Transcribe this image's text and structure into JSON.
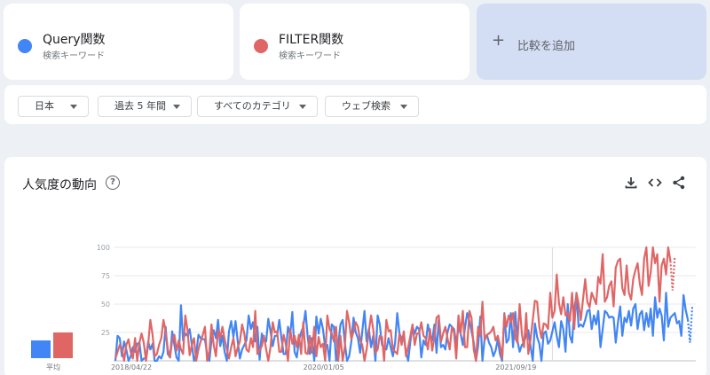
{
  "terms": [
    {
      "name": "Query関数",
      "subtitle": "検索キーワード",
      "color": "#4285f4"
    },
    {
      "name": "FILTER関数",
      "subtitle": "検索キーワード",
      "color": "#e06666"
    }
  ],
  "add_compare": {
    "plus": "+",
    "label": "比較を追加"
  },
  "filters": [
    {
      "label": "日本"
    },
    {
      "label": "過去 5 年間"
    },
    {
      "label": "すべてのカテゴリ"
    },
    {
      "label": "ウェブ検索"
    }
  ],
  "panel": {
    "title": "人気度の動向",
    "help": "?",
    "icons": [
      "download-icon",
      "embed-code-icon",
      "share-icon"
    ]
  },
  "average": {
    "label": "平均"
  },
  "chart_data": {
    "type": "line",
    "ylim": [
      0,
      100
    ],
    "y_ticks": [
      "100",
      "75",
      "50",
      "25"
    ],
    "x_ticks": [
      "2018/04/22",
      "2020/01/05",
      "2021/09/19"
    ],
    "x_tick_index": [
      0,
      88,
      176
    ],
    "average": [
      {
        "name": "Query関数",
        "value": 20
      },
      {
        "name": "FILTER関数",
        "value": 29
      }
    ],
    "series": [
      {
        "name": "Query関数",
        "color": "#4285f4",
        "values": [
          0,
          22,
          20,
          4,
          17,
          10,
          0,
          4,
          12,
          8,
          15,
          16,
          0,
          2,
          2,
          17,
          10,
          15,
          0,
          0,
          4,
          2,
          8,
          30,
          6,
          3,
          26,
          14,
          3,
          0,
          49,
          18,
          24,
          22,
          28,
          14,
          0,
          6,
          23,
          20,
          19,
          19,
          6,
          0,
          18,
          27,
          20,
          36,
          13,
          22,
          8,
          0,
          26,
          35,
          21,
          35,
          17,
          2,
          10,
          14,
          18,
          40,
          28,
          34,
          17,
          30,
          1,
          24,
          18,
          17,
          37,
          26,
          13,
          22,
          22,
          36,
          20,
          6,
          6,
          30,
          23,
          43,
          8,
          3,
          18,
          25,
          30,
          44,
          21,
          6,
          20,
          0,
          39,
          24,
          37,
          28,
          12,
          14,
          0,
          32,
          30,
          0,
          14,
          32,
          36,
          16,
          0,
          4,
          17,
          38,
          25,
          20,
          7,
          26,
          44,
          17,
          28,
          12,
          22,
          0,
          40,
          32,
          14,
          12,
          10,
          20,
          12,
          4,
          16,
          42,
          24,
          20,
          20,
          8,
          0,
          17,
          30,
          24,
          30,
          28,
          3,
          18,
          14,
          32,
          23,
          18,
          32,
          7,
          36,
          12,
          14,
          10,
          25,
          32,
          30,
          28,
          15,
          30,
          24,
          14,
          29,
          42,
          35,
          26,
          16,
          0,
          13,
          39,
          0,
          20,
          23,
          16,
          12,
          4,
          9,
          19,
          6,
          0,
          42,
          16,
          19,
          42,
          12,
          43,
          18,
          8,
          14,
          16,
          23,
          27,
          13,
          0,
          33,
          21,
          15,
          0,
          24,
          26,
          15,
          18,
          26,
          34,
          22,
          12,
          35,
          28,
          8,
          50,
          22,
          16,
          45,
          58,
          30,
          32,
          30,
          36,
          44,
          45,
          28,
          40,
          32,
          44,
          12,
          28,
          44,
          42,
          38,
          39,
          38,
          16,
          34,
          48,
          22,
          38,
          34,
          44,
          31,
          46,
          50,
          28,
          41,
          44,
          27,
          42,
          30,
          46,
          22,
          56,
          38,
          46,
          40,
          18,
          60,
          30,
          38,
          40,
          42,
          33,
          35,
          22,
          58,
          45,
          36,
          16,
          48
        ]
      },
      {
        "name": "FILTER関数",
        "color": "#e06666",
        "values": [
          2,
          8,
          14,
          11,
          0,
          14,
          19,
          8,
          2,
          20,
          0,
          16,
          24,
          16,
          0,
          14,
          36,
          23,
          4,
          6,
          14,
          20,
          36,
          26,
          10,
          3,
          18,
          23,
          9,
          18,
          10,
          6,
          40,
          27,
          5,
          14,
          20,
          0,
          10,
          17,
          23,
          30,
          0,
          8,
          32,
          14,
          4,
          27,
          20,
          30,
          19,
          10,
          2,
          12,
          20,
          4,
          12,
          17,
          32,
          24,
          10,
          8,
          20,
          12,
          44,
          6,
          9,
          13,
          22,
          10,
          0,
          12,
          34,
          25,
          26,
          8,
          8,
          23,
          15,
          0,
          28,
          15,
          22,
          12,
          23,
          6,
          34,
          7,
          6,
          22,
          7,
          30,
          4,
          21,
          12,
          15,
          0,
          40,
          28,
          24,
          17,
          30,
          0,
          22,
          0,
          12,
          44,
          34,
          19,
          26,
          34,
          30,
          18,
          14,
          0,
          10,
          26,
          40,
          28,
          7,
          10,
          22,
          21,
          0,
          36,
          26,
          27,
          10,
          8,
          6,
          24,
          14,
          26,
          4,
          12,
          22,
          32,
          14,
          24,
          24,
          34,
          22,
          20,
          10,
          28,
          9,
          21,
          38,
          40,
          17,
          24,
          30,
          20,
          10,
          30,
          25,
          2,
          40,
          24,
          44,
          12,
          12,
          44,
          38,
          10,
          0,
          30,
          22,
          52,
          18,
          23,
          24,
          26,
          30,
          18,
          22,
          14,
          2,
          41,
          30,
          40,
          34,
          42,
          20,
          16,
          50,
          24,
          12,
          42,
          6,
          19,
          36,
          53,
          52,
          30,
          20,
          33,
          32,
          28,
          60,
          38,
          44,
          76,
          51,
          41,
          56,
          40,
          42,
          35,
          60,
          28,
          60,
          50,
          36,
          54,
          72,
          52,
          47,
          60,
          55,
          50,
          74,
          68,
          94,
          52,
          56,
          66,
          70,
          48,
          82,
          88,
          90,
          64,
          58,
          84,
          60,
          54,
          72,
          80,
          86,
          68,
          58,
          90,
          100,
          66,
          78,
          100,
          86,
          94,
          52,
          84,
          90,
          76,
          100,
          88,
          62,
          92
        ]
      }
    ]
  }
}
